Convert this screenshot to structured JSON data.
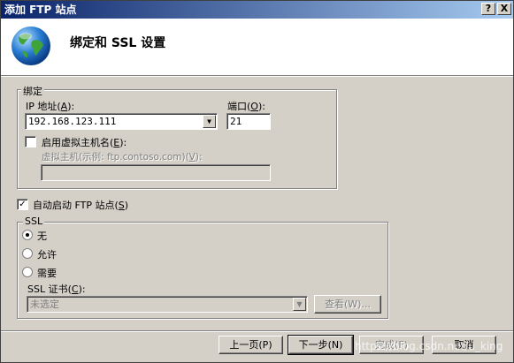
{
  "window": {
    "title": "添加 FTP 站点",
    "help_btn": "?",
    "close_btn": "X"
  },
  "header": {
    "title": "绑定和 SSL 设置"
  },
  "binding": {
    "group_label": "绑定",
    "ip_label_pre": "IP 地址(",
    "ip_label_key": "A",
    "ip_label_post": "):",
    "ip_value": "192.168.123.111",
    "port_label_pre": "端口(",
    "port_label_key": "O",
    "port_label_post": "):",
    "port_value": "21",
    "vhost_check_pre": "启用虚拟主机名(",
    "vhost_check_key": "E",
    "vhost_check_post": "):",
    "vhost_label_pre": "虚拟主机(示例: ftp.contoso.com)(",
    "vhost_label_key": "V",
    "vhost_label_post": "):",
    "vhost_value": ""
  },
  "autostart": {
    "label_pre": "自动启动 FTP 站点(",
    "label_key": "S",
    "label_post": ")",
    "checked": true
  },
  "ssl": {
    "group_label": "SSL",
    "options": [
      "无",
      "允许",
      "需要"
    ],
    "selected": "无",
    "cert_label_pre": "SSL 证书(",
    "cert_label_key": "C",
    "cert_label_post": "):",
    "cert_value": "未选定",
    "view_btn": "查看(W)..."
  },
  "footer": {
    "prev": "上一页(P)",
    "next": "下一步(N)",
    "finish": "完成(F)",
    "cancel": "取消"
  },
  "watermark": "https://blog.csdn.net/u_king"
}
